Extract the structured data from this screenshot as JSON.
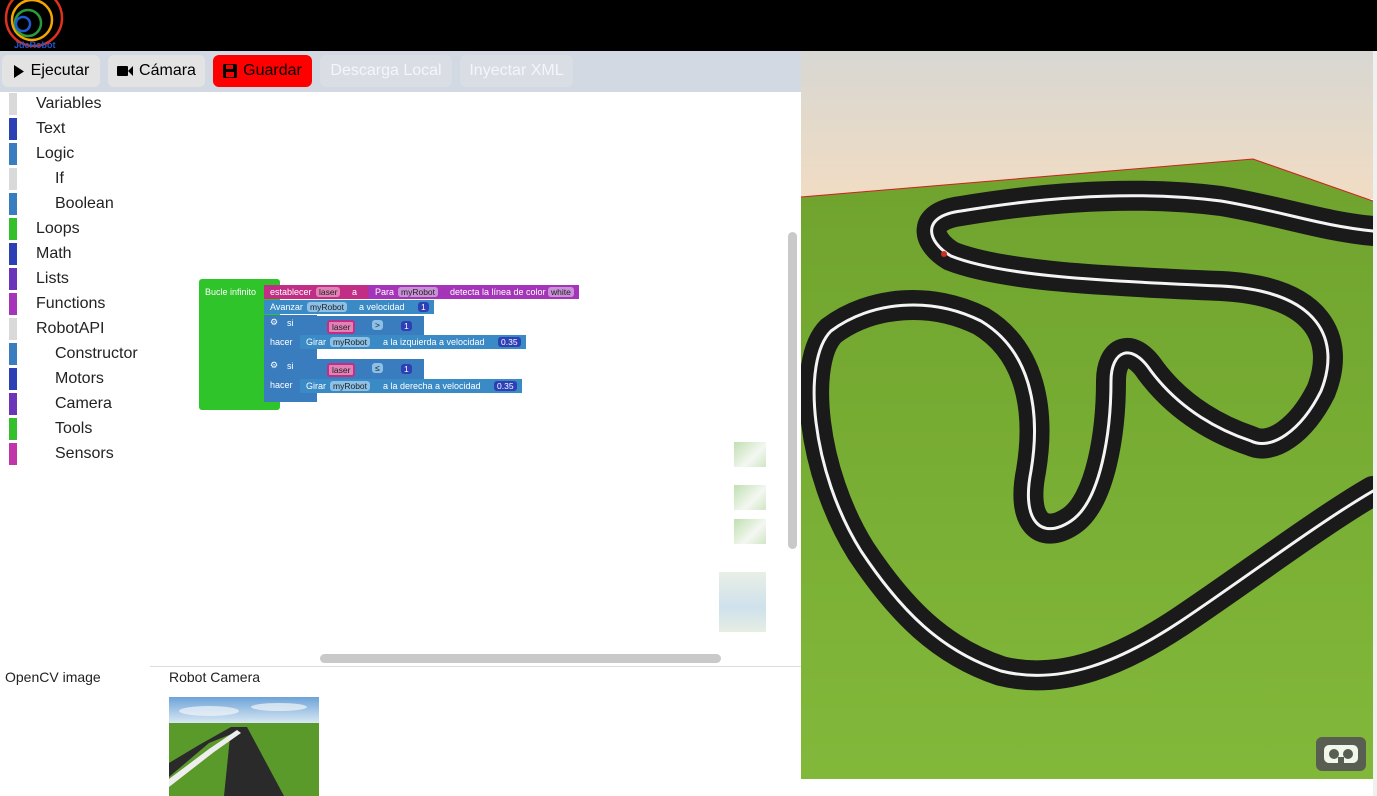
{
  "header": {
    "logo_text": "JdeRobot"
  },
  "toolbar": {
    "run": "Ejecutar",
    "camera": "Cámara",
    "save": "Guardar",
    "download": "Descarga Local",
    "inject": "Inyectar XML",
    "colors": {
      "save_bg": "#ff0000",
      "bar_bg": "#d3d9e3"
    }
  },
  "toolbox": {
    "items": [
      {
        "label": "Variables",
        "color": "#d9d9d9"
      },
      {
        "label": "Text",
        "color": "#2d3fb5"
      },
      {
        "label": "Logic",
        "color": "#3a7dbf"
      },
      {
        "label": "If",
        "color": "#d9d9d9"
      },
      {
        "label": "Boolean",
        "color": "#3a7dbf"
      },
      {
        "label": "Loops",
        "color": "#33c02b"
      },
      {
        "label": "Math",
        "color": "#2d3fb5"
      },
      {
        "label": "Lists",
        "color": "#6a35b8"
      },
      {
        "label": "Functions",
        "color": "#a535b8"
      },
      {
        "label": "RobotAPI",
        "color": "#d9d9d9"
      },
      {
        "label": "Constructor",
        "color": "#3a7dbf"
      },
      {
        "label": "Motors",
        "color": "#2d3fb5"
      },
      {
        "label": "Camera",
        "color": "#6a35b8"
      },
      {
        "label": "Tools",
        "color": "#33c02b"
      },
      {
        "label": "Sensors",
        "color": "#c035a8"
      }
    ]
  },
  "blocks": {
    "loop": "Bucle infinito",
    "set": "establecer",
    "var_laser": "laser",
    "to": "a",
    "for": "Para",
    "robot": "myRobot",
    "detect": "detecta la línea de color",
    "color_white": "white",
    "advance": "Avanzar",
    "at_speed": "a velocidad",
    "val_1": "1",
    "if": "si",
    "do": "hacer",
    "op_gt": ">",
    "op_le": "≤",
    "turn": "Girar",
    "left_speed": "a la izquierda a velocidad",
    "right_speed": "a la derecha a velocidad",
    "val_035": "0.35"
  },
  "panels": {
    "opencv": "OpenCV image",
    "robot_camera": "Robot Camera"
  }
}
